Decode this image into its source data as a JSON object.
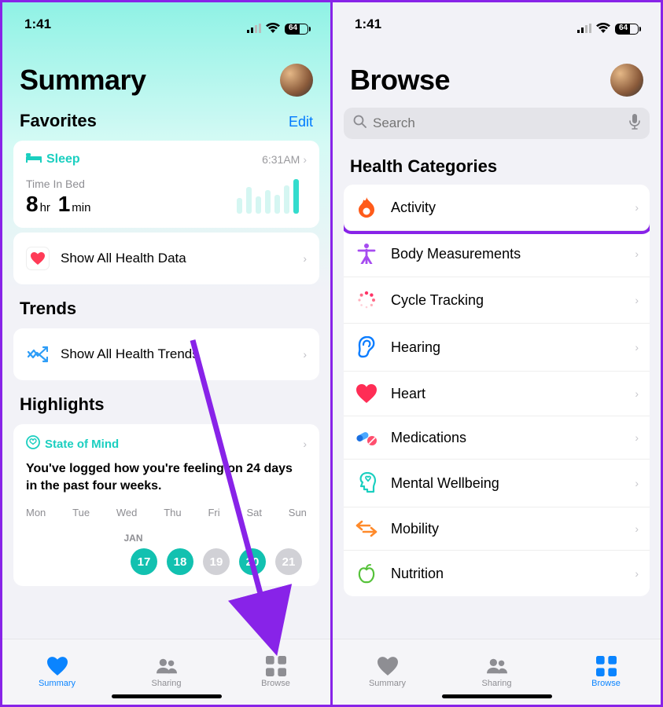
{
  "status": {
    "time": "1:41",
    "battery": "64"
  },
  "left": {
    "title": "Summary",
    "favorites": {
      "label": "Favorites",
      "edit": "Edit"
    },
    "sleep": {
      "name": "Sleep",
      "timestamp": "6:31AM",
      "metric_label": "Time In Bed",
      "hours": "8",
      "hr_unit": "hr",
      "minutes": "1",
      "min_unit": "min"
    },
    "show_all": "Show All Health Data",
    "trends_label": "Trends",
    "trends_link": "Show All Health Trends",
    "highlights_label": "Highlights",
    "som_label": "State of Mind",
    "hl_text": "You've logged how you're feeling on 24 days in the past four weeks.",
    "days": [
      "Mon",
      "Tue",
      "Wed",
      "Thu",
      "Fri",
      "Sat",
      "Sun"
    ],
    "month": "JAN",
    "dates": [
      {
        "n": "17",
        "on": true
      },
      {
        "n": "18",
        "on": true
      },
      {
        "n": "19",
        "on": false
      },
      {
        "n": "20",
        "on": true
      },
      {
        "n": "21",
        "on": false
      }
    ],
    "tabs": {
      "summary": "Summary",
      "sharing": "Sharing",
      "browse": "Browse"
    }
  },
  "right": {
    "title": "Browse",
    "search_placeholder": "Search",
    "cat_label": "Health Categories",
    "items": [
      {
        "label": "Activity"
      },
      {
        "label": "Body Measurements"
      },
      {
        "label": "Cycle Tracking"
      },
      {
        "label": "Hearing"
      },
      {
        "label": "Heart"
      },
      {
        "label": "Medications"
      },
      {
        "label": "Mental Wellbeing"
      },
      {
        "label": "Mobility"
      },
      {
        "label": "Nutrition"
      }
    ],
    "tabs": {
      "summary": "Summary",
      "sharing": "Sharing",
      "browse": "Browse"
    }
  }
}
